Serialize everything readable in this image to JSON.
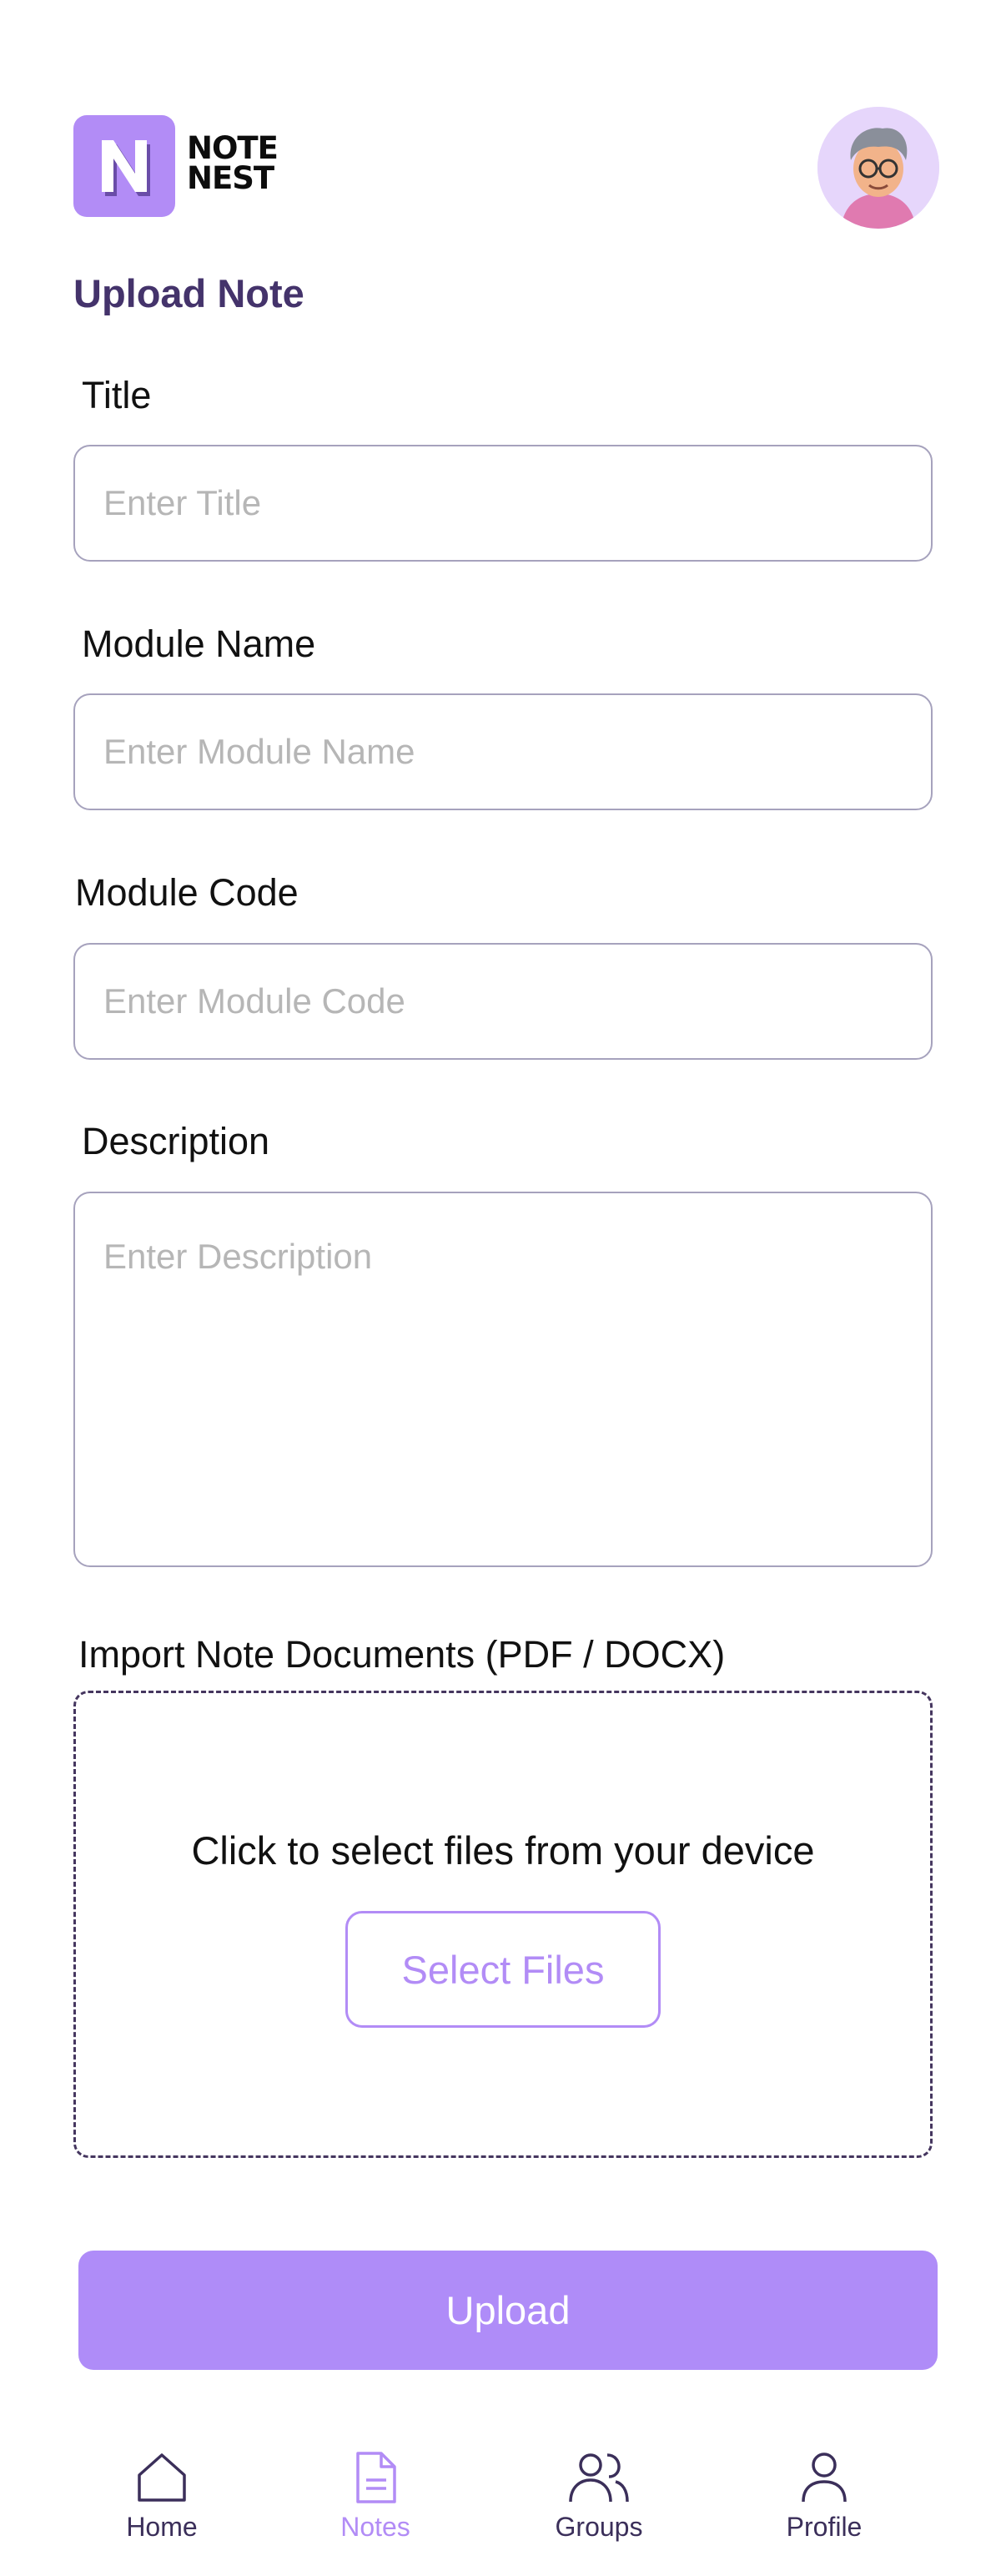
{
  "brand": {
    "name_line1": "NOTE",
    "name_line2": "NEST",
    "logo_letter": "N"
  },
  "page": {
    "title": "Upload Note"
  },
  "form": {
    "title_label": "Title",
    "title_placeholder": "Enter Title",
    "module_name_label": "Module Name",
    "module_name_placeholder": "Enter Module Name",
    "module_code_label": "Module Code",
    "module_code_placeholder": "Enter Module Code",
    "description_label": "Description",
    "description_placeholder": "Enter Description",
    "import_label": "Import Note Documents (PDF / DOCX)",
    "dropzone_text": "Click to select files from your device",
    "select_files_label": "Select Files",
    "upload_label": "Upload"
  },
  "nav": {
    "items": [
      {
        "label": "Home",
        "icon": "home-icon",
        "active": false
      },
      {
        "label": "Notes",
        "icon": "document-icon",
        "active": true
      },
      {
        "label": "Groups",
        "icon": "users-icon",
        "active": false
      },
      {
        "label": "Profile",
        "icon": "user-icon",
        "active": false
      }
    ]
  },
  "colors": {
    "accent": "#b28cf6",
    "title": "#44336b",
    "nav_inactive": "#3b2f5a",
    "field_border": "#a6a2bd"
  }
}
